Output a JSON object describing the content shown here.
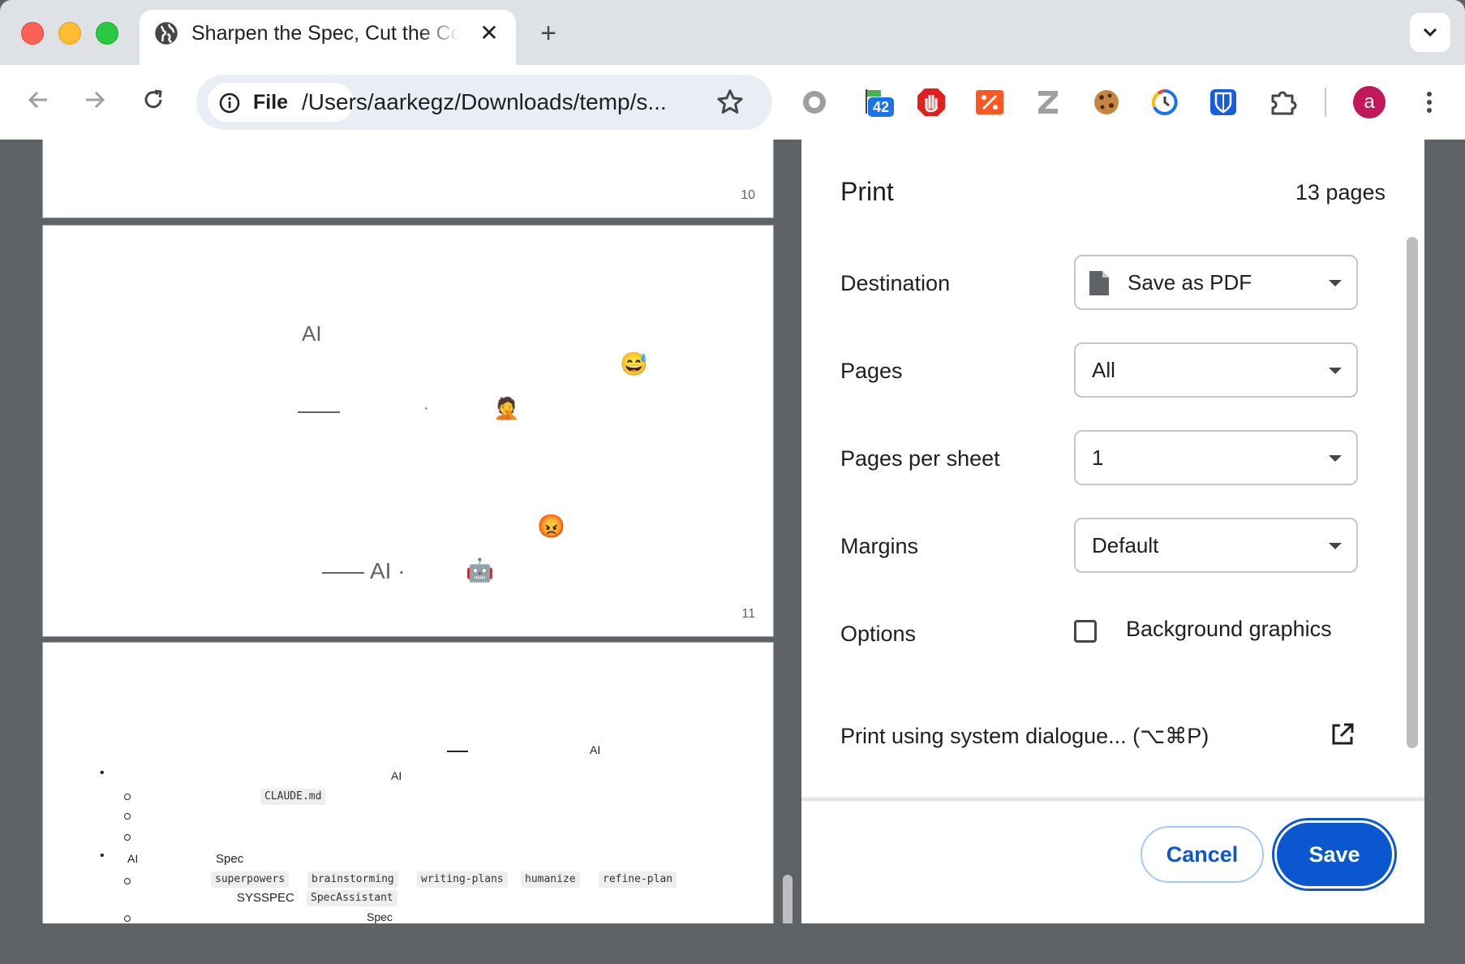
{
  "tab": {
    "title": "Sharpen the Spec, Cut the Context",
    "close": "✕"
  },
  "new_tab": "+",
  "omnibox": {
    "chip_label": "File",
    "url": "/Users/aarkegz/Downloads/temp/s..."
  },
  "extensions": {
    "badge_count": "42",
    "icons": [
      "circle-extension-icon",
      "badge-extension-icon",
      "ublock-icon",
      "percent-extension-icon",
      "z-extension-icon",
      "cookie-icon",
      "timer-icon",
      "bitwarden-icon",
      "puzzle-icon"
    ]
  },
  "profile": {
    "initial": "a"
  },
  "preview": {
    "page10_number": "10",
    "page11": {
      "number": "11",
      "text_ai_top": "AI",
      "text_ai_bottom": "AI ·",
      "dot": "·",
      "emojis": [
        "😅",
        "🤦",
        "😡",
        "🤖"
      ]
    },
    "page12": {
      "header_ai": "AI",
      "item1_ai": "AI",
      "code_claude": "CLAUDE.md",
      "item2_ai": "AI",
      "item2_spec": "Spec",
      "codes": [
        "superpowers",
        "brainstorming",
        "writing-plans",
        "humanize",
        "refine-plan"
      ],
      "sysspec": "SYSSPEC",
      "code_specassistant": "SpecAssistant",
      "spec_cut": "Spec"
    }
  },
  "dialog": {
    "title": "Print",
    "page_count": "13 pages",
    "destination_label": "Destination",
    "destination_value": "Save as PDF",
    "pages_label": "Pages",
    "pages_value": "All",
    "pps_label": "Pages per sheet",
    "pps_value": "1",
    "margins_label": "Margins",
    "margins_value": "Default",
    "options_label": "Options",
    "background_graphics": "Background graphics",
    "background_graphics_checked": false,
    "system_dialog": "Print using system dialogue... (⌥⌘P)",
    "cancel": "Cancel",
    "save": "Save"
  },
  "colors": {
    "accent": "#0b57d0",
    "avatar": "#c2185b"
  }
}
